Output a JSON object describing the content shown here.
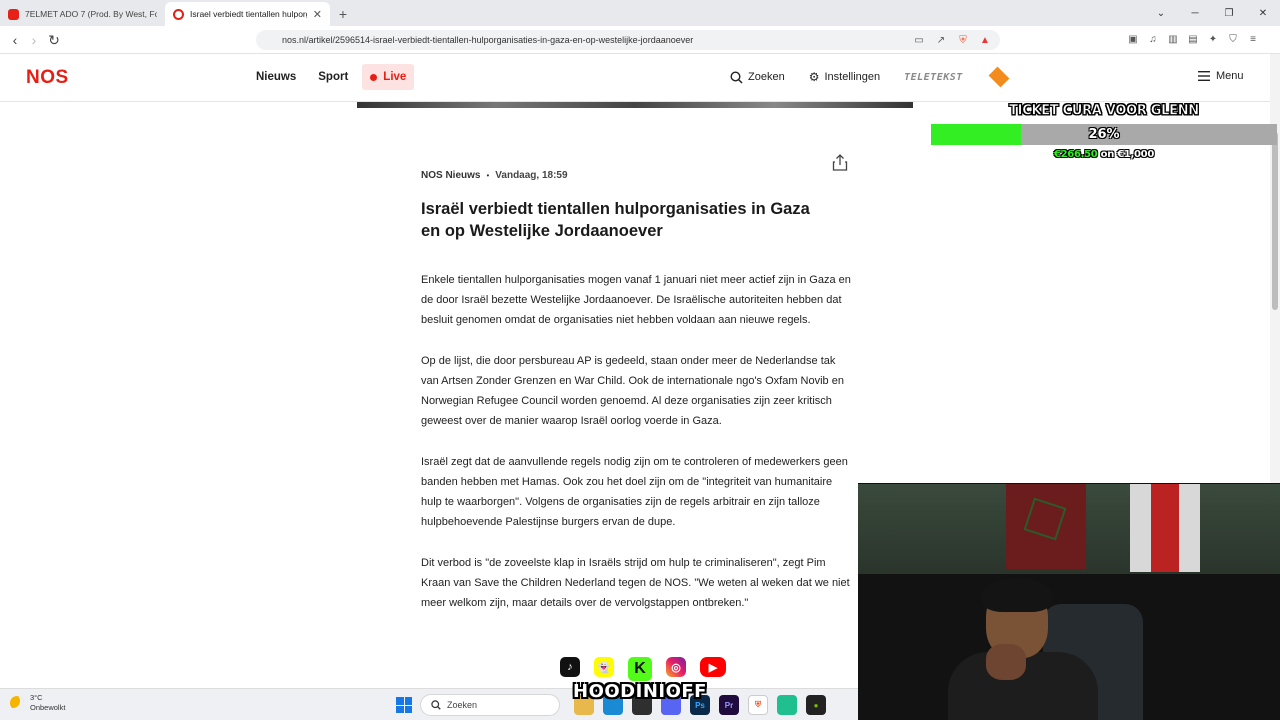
{
  "browser": {
    "tabs": [
      {
        "title": "7ELMET ADO 7 (Prod. By West, Fonik"
      },
      {
        "title": "Israel verbiedt tientallen hulporg"
      }
    ],
    "new_tab": "+",
    "url": "nos.nl/artikel/2596514-israel-verbiedt-tientallen-hulporganisaties-in-gaza-en-op-westelijke-jordaanoever"
  },
  "site": {
    "logo": "NOS",
    "nav": {
      "news": "Nieuws",
      "sport": "Sport",
      "live": "Live"
    },
    "right": {
      "search": "Zoeken",
      "settings": "Instellingen",
      "teletekst": "TELETEKST",
      "menu": "Menu"
    }
  },
  "article": {
    "source": "NOS Nieuws",
    "separator": "•",
    "time": "Vandaag, 18:59",
    "title": "Israël verbiedt tientallen hulporganisaties in Gaza en op Westelijke Jordaanoever",
    "paragraphs": [
      "Enkele tientallen hulporganisaties mogen vanaf 1 januari niet meer actief zijn in Gaza en de door Israël bezette Westelijke Jordaanoever. De Israëlische autoriteiten hebben dat besluit genomen omdat de organisaties niet hebben voldaan aan nieuwe regels.",
      "Op de lijst, die door persbureau AP is gedeeld, staan onder meer de Nederlandse tak van Artsen Zonder Grenzen en War Child. Ook de internationale ngo's Oxfam Novib en Norwegian Refugee Council worden genoemd. Al deze organisaties zijn zeer kritisch geweest over de manier waarop Israël oorlog voerde in Gaza.",
      "Israël zegt dat de aanvullende regels nodig zijn om te controleren of medewerkers geen banden hebben met Hamas. Ook zou het doel zijn om de \"integriteit van humanitaire hulp te waarborgen\". Volgens de organisaties zijn de regels arbitrair en zijn talloze hulpbehoevende Palestijnse burgers ervan de dupe.",
      "Dit verbod is \"de zoveelste klap in Israëls strijd om hulp te criminaliseren\", zegt Pim Kraan van Save the Children Nederland tegen de NOS. \"We weten al weken dat we niet meer welkom zijn, maar details over de vervolgstappen ontbreken.\""
    ]
  },
  "goal": {
    "title": "TICKET CURA VOOR GLENN",
    "percent_label": "26%",
    "progress": 0.26,
    "current": "€266.50",
    "sep": "on",
    "target": "€1,000",
    "colors": {
      "fill": "#33ee22",
      "track": "#a9a9a9"
    }
  },
  "stream": {
    "handle": "HOODINIOFF",
    "socials": [
      "tiktok-icon",
      "snapchat-icon",
      "kick-icon",
      "instagram-icon",
      "youtube-icon"
    ]
  },
  "taskbar": {
    "temp": "3°C",
    "condition": "Onbewolkt",
    "search": "Zoeken",
    "apps": [
      "file-explorer-icon",
      "edge-icon",
      "store-icon",
      "discord-icon",
      "photoshop-icon",
      "premiere-icon",
      "brave-icon",
      "app-icon",
      "nvidia-icon"
    ]
  },
  "colors": {
    "nos_red": "#e61e14",
    "live_bg": "#fde2e2"
  }
}
